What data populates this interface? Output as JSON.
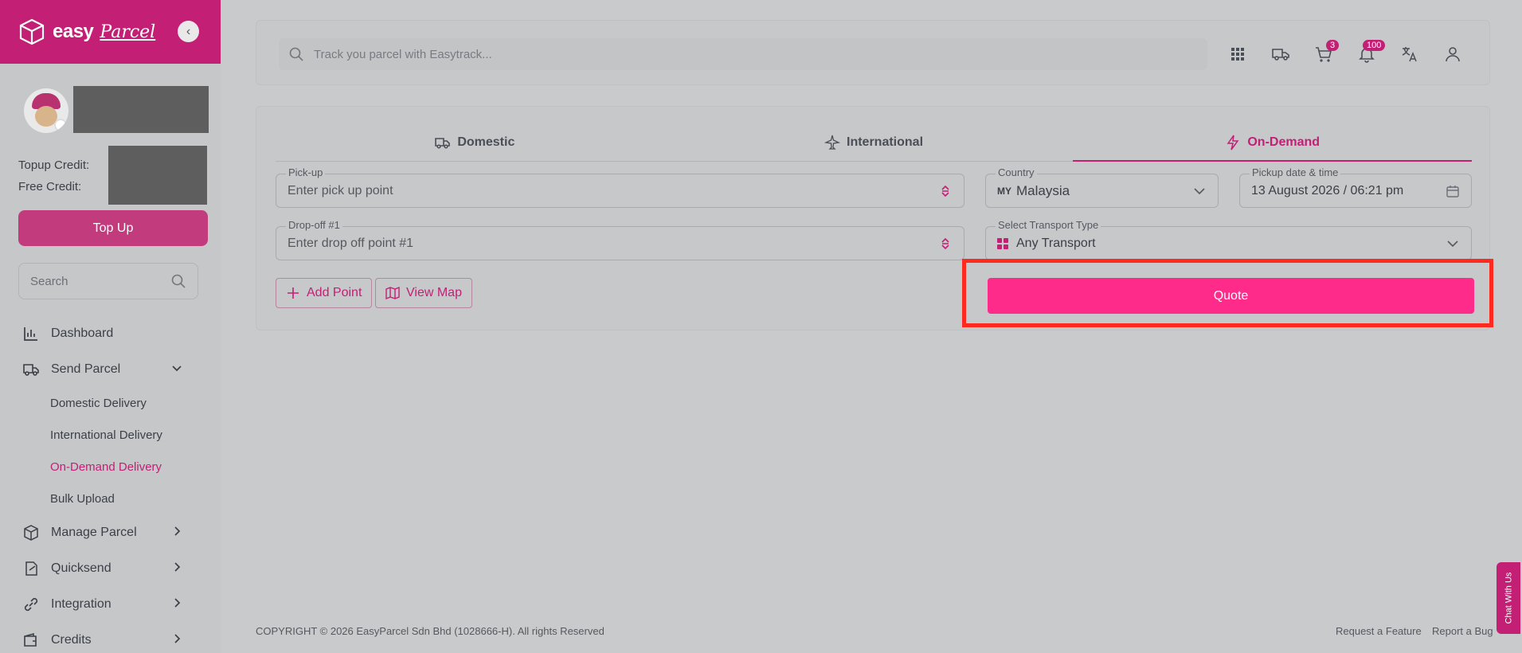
{
  "sidebar": {
    "brand": "easy",
    "brand_script": "Parcel",
    "topup_credit_label": "Topup Credit:",
    "free_credit_label": "Free Credit:",
    "topup_button": "Top Up",
    "search_placeholder": "Search",
    "nav": [
      {
        "label": "Dashboard",
        "icon": "chart-icon"
      },
      {
        "label": "Send Parcel",
        "icon": "truck-icon",
        "expanded": true
      },
      {
        "label": "Manage Parcel",
        "icon": "box-icon"
      },
      {
        "label": "Quicksend",
        "icon": "quicksend-icon"
      },
      {
        "label": "Integration",
        "icon": "link-icon"
      },
      {
        "label": "Credits",
        "icon": "wallet-icon"
      }
    ],
    "send_parcel_sub": [
      {
        "label": "Domestic Delivery"
      },
      {
        "label": "International Delivery"
      },
      {
        "label": "On-Demand Delivery",
        "active": true
      },
      {
        "label": "Bulk Upload"
      }
    ]
  },
  "topbar": {
    "track_placeholder": "Track you parcel with Easytrack...",
    "cart_badge": "3",
    "notif_badge": "100"
  },
  "tabs": [
    {
      "label": "Domestic",
      "icon": "truck-icon"
    },
    {
      "label": "International",
      "icon": "plane-icon"
    },
    {
      "label": "On-Demand",
      "icon": "lightning-icon",
      "active": true
    }
  ],
  "form": {
    "pickup_label": "Pick-up",
    "pickup_placeholder": "Enter pick up point",
    "country_label": "Country",
    "country_code": "MY",
    "country_value": "Malaysia",
    "datetime_label": "Pickup date & time",
    "datetime_value": "13 August 2026 / 06:21 pm",
    "dropoff_label": "Drop-off #1",
    "dropoff_placeholder": "Enter drop off point #1",
    "transport_label": "Select Transport Type",
    "transport_value": "Any Transport",
    "add_point": "Add Point",
    "view_map": "View Map",
    "quote": "Quote"
  },
  "footer": {
    "copyright": "COPYRIGHT © 2026 EasyParcel Sdn Bhd (1028666-H). All rights Reserved",
    "request_feature": "Request a Feature",
    "report_bug": "Report a Bug"
  },
  "chat": "Chat With Us",
  "colors": {
    "brand": "#c21f75",
    "quote": "#ff2b8b",
    "highlight": "#ff2a1f"
  }
}
